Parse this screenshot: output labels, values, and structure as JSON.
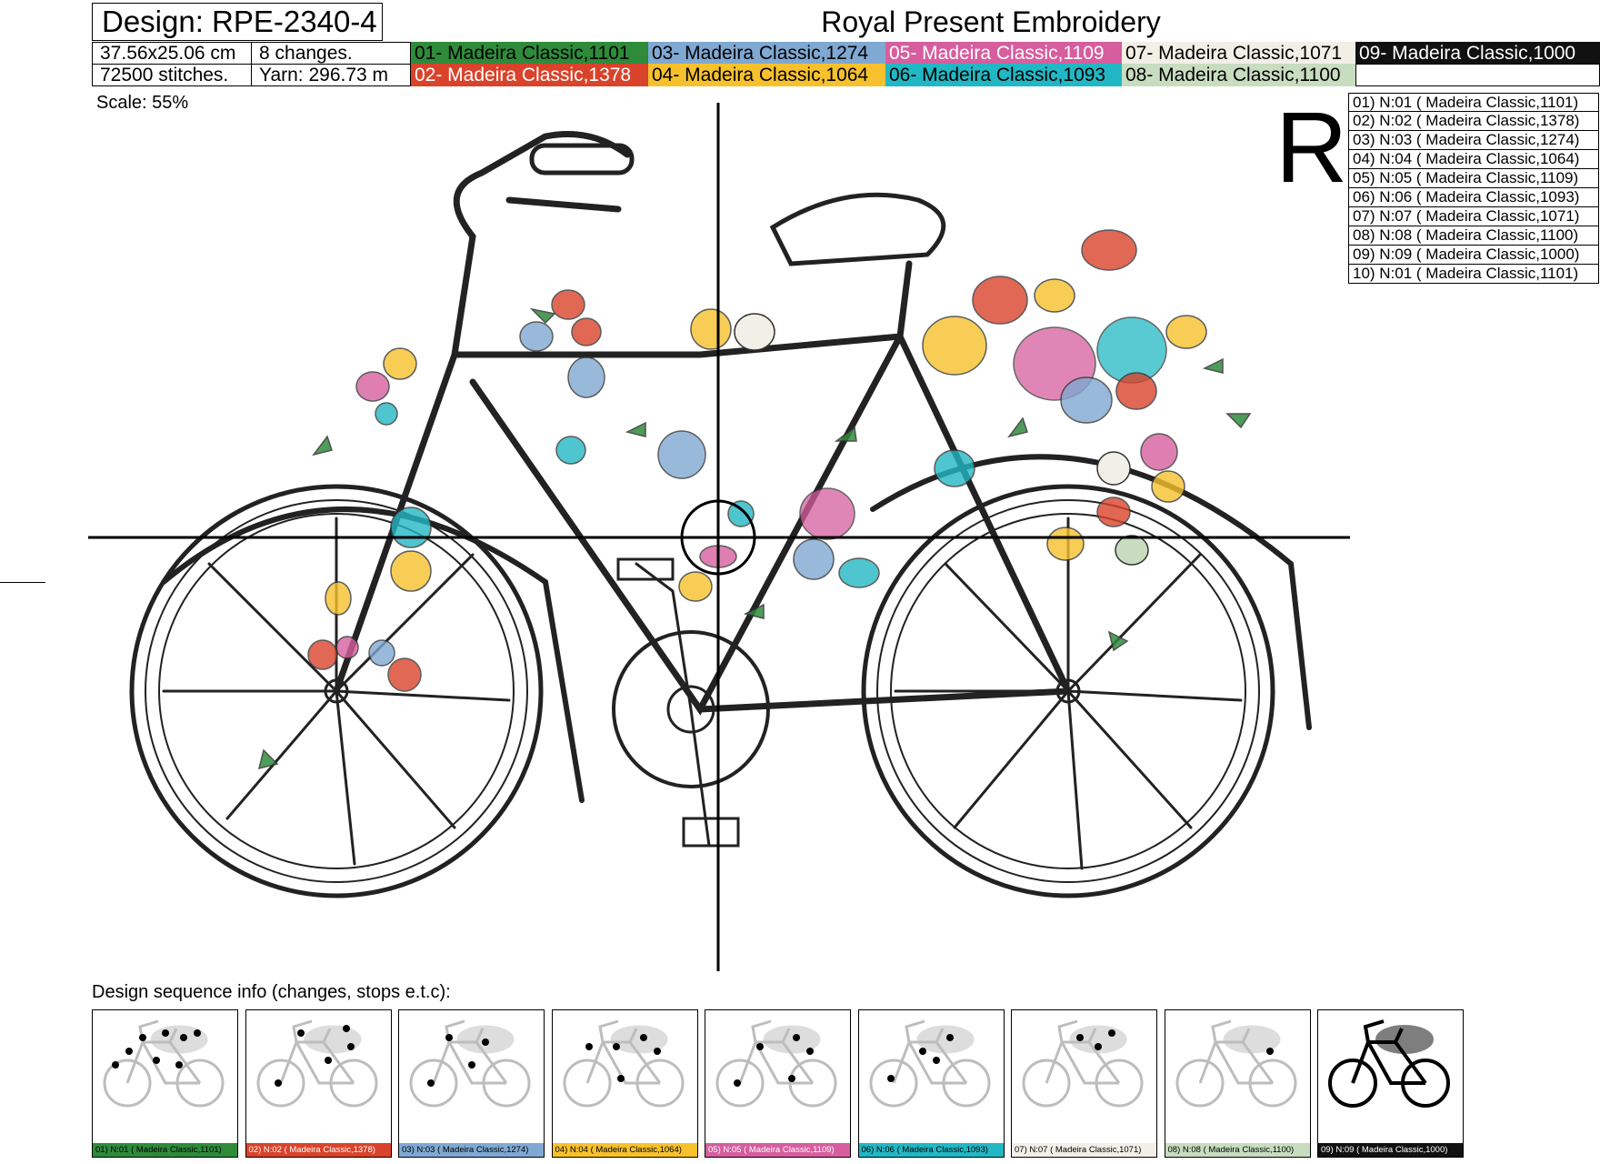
{
  "header": {
    "design_title": "Design: RPE-2340-4",
    "company": "Royal Present Embroidery",
    "size": "37.56x25.06 cm",
    "changes": "8 changes.",
    "stitches": "72500 stitches.",
    "yarn": "Yarn: 296.73 m"
  },
  "colors": [
    {
      "label": "01- Madeira Classic,1101",
      "bg": "#2e8b3a",
      "fg": "#000000"
    },
    {
      "label": "02- Madeira Classic,1378",
      "bg": "#d9432b",
      "fg": "#ffffff"
    },
    {
      "label": "03- Madeira Classic,1274",
      "bg": "#7fa8d2",
      "fg": "#000000"
    },
    {
      "label": "04- Madeira Classic,1064",
      "bg": "#f6c12c",
      "fg": "#000000"
    },
    {
      "label": "05- Madeira Classic,1109",
      "bg": "#d65e9e",
      "fg": "#ffffff"
    },
    {
      "label": "06- Madeira Classic,1093",
      "bg": "#22b7c4",
      "fg": "#000000"
    },
    {
      "label": "07- Madeira Classic,1071",
      "bg": "#f2efe6",
      "fg": "#000000"
    },
    {
      "label": "08- Madeira Classic,1100",
      "bg": "#c8dcc0",
      "fg": "#000000"
    },
    {
      "label": "09- Madeira Classic,1000",
      "bg": "#111111",
      "fg": "#ffffff"
    }
  ],
  "scale": "Scale: 55%",
  "hoop_letter": "R",
  "stops": [
    "01) N:01 ( Madeira Classic,1101)",
    "02) N:02 ( Madeira Classic,1378)",
    "03) N:03 ( Madeira Classic,1274)",
    "04) N:04 ( Madeira Classic,1064)",
    "05) N:05 ( Madeira Classic,1109)",
    "06) N:06 ( Madeira Classic,1093)",
    "07) N:07 ( Madeira Classic,1071)",
    "08) N:08 ( Madeira Classic,1100)",
    "09) N:09 ( Madeira Classic,1000)",
    "10) N:01 ( Madeira Classic,1101)"
  ],
  "sequence": {
    "label": "Design sequence info (changes, stops e.t.c):",
    "thumbs": [
      {
        "caption": "01) N:01 ( Madeira Classic,1101)",
        "bg": "#2e8b3a",
        "fg": "#000000"
      },
      {
        "caption": "02) N:02 ( Madeira Classic,1378)",
        "bg": "#d9432b",
        "fg": "#ffffff"
      },
      {
        "caption": "03) N:03 ( Madeira Classic,1274)",
        "bg": "#7fa8d2",
        "fg": "#000000"
      },
      {
        "caption": "04) N:04 ( Madeira Classic,1064)",
        "bg": "#f6c12c",
        "fg": "#000000"
      },
      {
        "caption": "05) N:05 ( Madeira Classic,1109)",
        "bg": "#d65e9e",
        "fg": "#ffffff"
      },
      {
        "caption": "06) N:06 ( Madeira Classic,1093)",
        "bg": "#22b7c4",
        "fg": "#000000"
      },
      {
        "caption": "07) N:07 ( Madeira Classic,1071)",
        "bg": "#f2efe6",
        "fg": "#000000"
      },
      {
        "caption": "08) N:08 ( Madeira Classic,1100)",
        "bg": "#c8dcc0",
        "fg": "#000000"
      },
      {
        "caption": "09) N:09 ( Madeira Classic,1000)",
        "bg": "#111111",
        "fg": "#ffffff"
      }
    ]
  }
}
